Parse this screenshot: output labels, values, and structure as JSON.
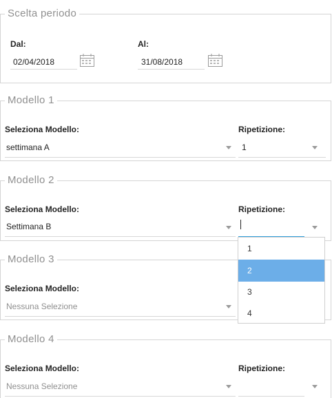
{
  "periodo": {
    "legend": "Scelta periodo",
    "dal_label": "Dal:",
    "dal_value": "02/04/2018",
    "al_label": "Al:",
    "al_value": "31/08/2018"
  },
  "modelli": [
    {
      "legend": "Modello 1",
      "modello_label": "Seleziona Modello:",
      "modello_value": "settimana A",
      "rip_label": "Ripetizione:",
      "rip_value": "1"
    },
    {
      "legend": "Modello 2",
      "modello_label": "Seleziona Modello:",
      "modello_value": "Settimana B",
      "rip_label": "Ripetizione:",
      "rip_value": ""
    },
    {
      "legend": "Modello 3",
      "modello_label": "Seleziona Modello:",
      "modello_value": "Nessuna Selezione"
    },
    {
      "legend": "Modello 4",
      "modello_label": "Seleziona Modello:",
      "modello_value": "Nessuna Selezione",
      "rip_label": "Ripetizione:",
      "rip_value": ""
    }
  ],
  "ripetizione_dropdown": {
    "options": [
      "1",
      "2",
      "3",
      "4"
    ],
    "highlighted": "2"
  },
  "colors": {
    "accent": "#2f9fdc",
    "highlight": "#6caee8",
    "legend_text": "#8f8f8f",
    "border": "#d4d4d4"
  },
  "icons": {
    "date_picker": "calendar-icon",
    "select_arrow": "caret-down-icon"
  }
}
